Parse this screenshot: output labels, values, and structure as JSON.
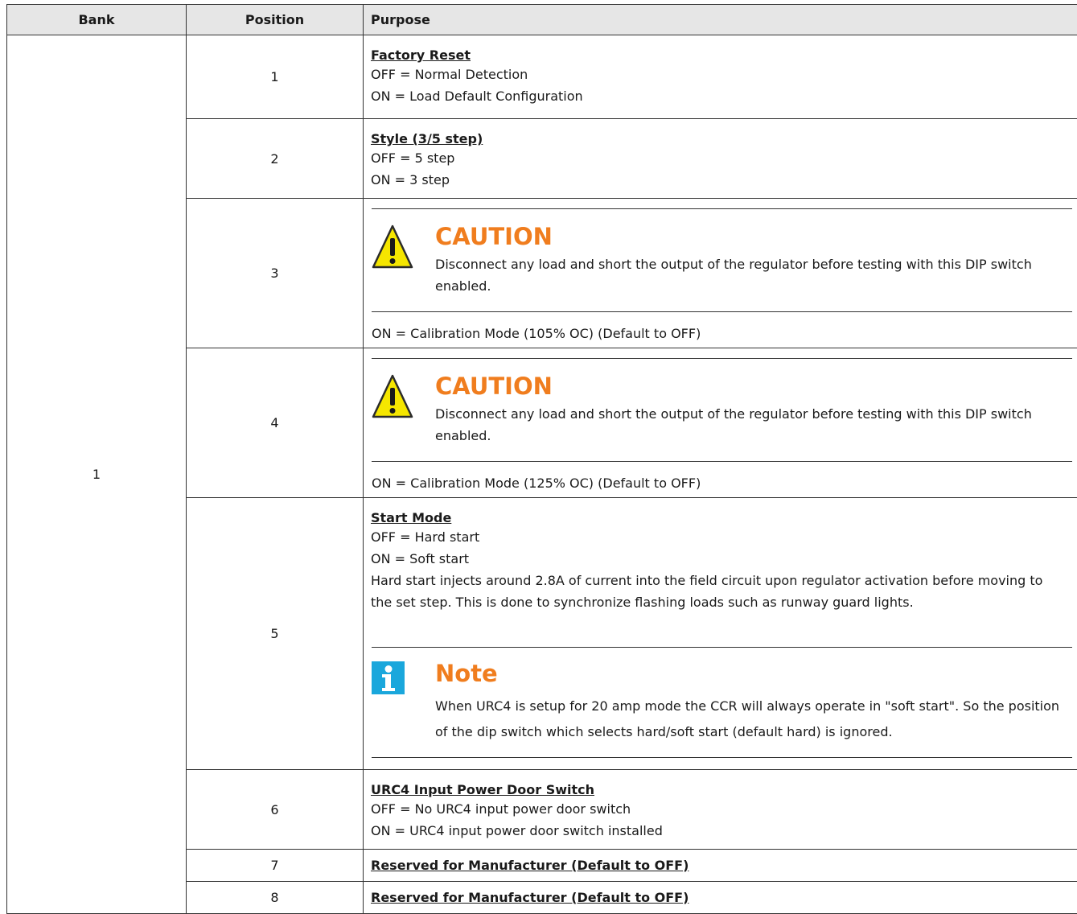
{
  "table": {
    "headers": {
      "bank": "Bank",
      "position": "Position",
      "purpose": "Purpose"
    },
    "bank_value": "1",
    "rows": [
      {
        "position": "1",
        "title": "Factory Reset",
        "lines": [
          "OFF = Normal Detection",
          "ON = Load Default Configuration"
        ]
      },
      {
        "position": "2",
        "title": "Style (3/5 step)",
        "lines": [
          "OFF = 5 step",
          "ON = 3 step"
        ]
      },
      {
        "position": "3",
        "caution_heading": "CAUTION",
        "caution_text": "Disconnect any load and short the output of the regulator before testing with this DIP switch enabled.",
        "setting": "ON = Calibration Mode (105% OC) (Default to OFF)"
      },
      {
        "position": "4",
        "caution_heading": "CAUTION",
        "caution_text": "Disconnect any load and short the output of the regulator before testing with this DIP switch enabled.",
        "setting": "ON = Calibration Mode (125% OC) (Default to OFF)"
      },
      {
        "position": "5",
        "title": "Start Mode",
        "lines": [
          "OFF = Hard start",
          "ON = Soft start"
        ],
        "paragraph": "Hard start injects around 2.8A of current into the field circuit upon regulator activation before moving to the set step. This is done to synchronize flashing loads such as runway guard lights.",
        "note_heading": "Note",
        "note_text": "When URC4 is setup for 20 amp mode the CCR will always operate in \"soft start\". So the position of the dip switch which selects hard/soft start (default hard) is ignored."
      },
      {
        "position": "6",
        "title": "URC4 Input Power Door Switch",
        "lines": [
          "OFF = No URC4 input power door switch",
          "ON = URC4 input power door switch installed"
        ]
      },
      {
        "position": "7",
        "title": "Reserved for Manufacturer (Default to OFF)"
      },
      {
        "position": "8",
        "title": "Reserved for Manufacturer (Default to OFF)"
      }
    ]
  },
  "colors": {
    "caution": "#f07d1e",
    "note_icon": "#1aa7dc",
    "header_bg": "#e6e6e6",
    "warning_triangle": "#f5e600"
  },
  "icons": {
    "caution": "warning-triangle-icon",
    "note": "info-icon"
  }
}
